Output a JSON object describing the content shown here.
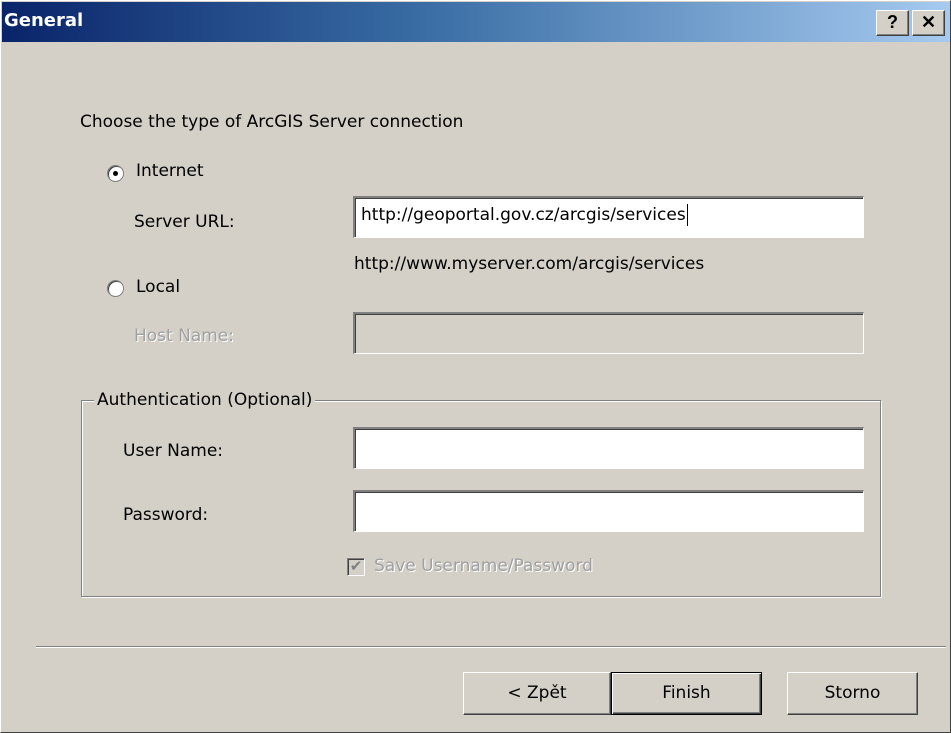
{
  "window": {
    "title": "General",
    "help_label": "?",
    "close_label": "✕"
  },
  "connection": {
    "prompt": "Choose the type of ArcGIS Server connection",
    "internet_label": "Internet",
    "internet_selected": true,
    "server_url_label": "Server URL:",
    "server_url_value": "http://geoportal.gov.cz/arcgis/services",
    "server_url_example": "http://www.myserver.com/arcgis/services",
    "local_label": "Local",
    "local_selected": false,
    "host_name_label": "Host Name:",
    "host_name_value": ""
  },
  "authentication": {
    "group_label": "Authentication (Optional)",
    "user_name_label": "User Name:",
    "user_name_value": "",
    "password_label": "Password:",
    "password_value": "",
    "save_label": "Save Username/Password",
    "save_checked": true,
    "save_enabled": false
  },
  "buttons": {
    "back_label": "< Zpět",
    "finish_label": "Finish",
    "cancel_label": "Storno"
  }
}
